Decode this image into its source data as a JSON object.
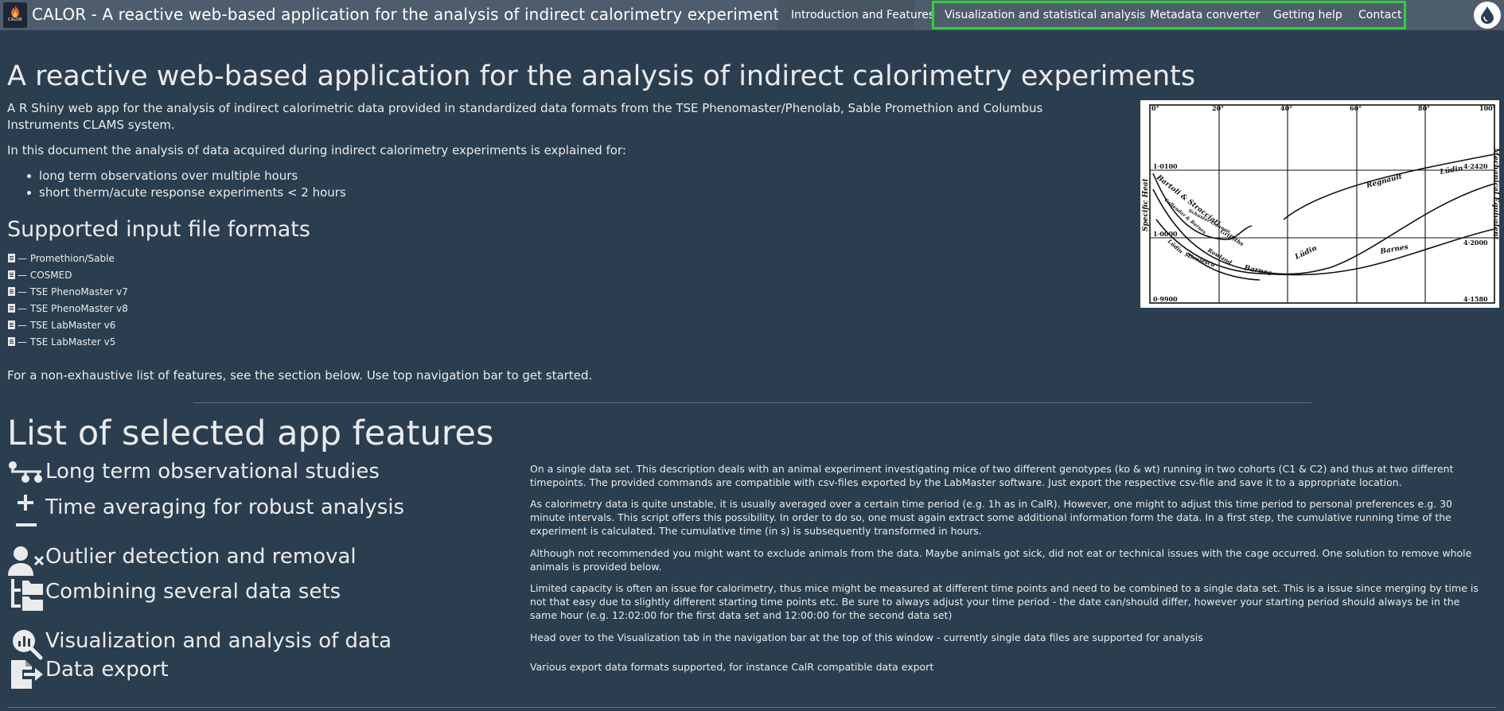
{
  "navbar": {
    "logo_text": "CALOR",
    "brand_title": "CALOR - A reactive web-based application for the analysis of indirect calorimetry experiments",
    "items": [
      {
        "label": "Introduction and Features"
      },
      {
        "label": "Visualization and statistical analysis"
      },
      {
        "label": "Metadata converter"
      },
      {
        "label": "Getting help"
      },
      {
        "label": "Contact"
      }
    ]
  },
  "intro": {
    "heading": "A reactive web-based application for the analysis of indirect calorimetry experiments",
    "paragraph1": "A R Shiny web app for the analysis of indirect calorimetric data provided in standardized data formats from the TSE Phenomaster/Phenolab, Sable Promethion and Columbus Instruments CLAMS system.",
    "paragraph2": "In this document the analysis of data acquired during indirect calorimetry experiments is explained for:",
    "bullets": [
      "long term observations over multiple hours",
      "short therm/acute response experiments < 2 hours"
    ]
  },
  "formats": {
    "heading": "Supported input file formats",
    "items": [
      "— Promethion/Sable",
      "— COSMED",
      "— TSE PhenoMaster v7",
      "— TSE PhenoMaster v8",
      "— TSE LabMaster v6",
      "— TSE LabMaster v5"
    ],
    "footer_text": "For a non-exhaustive list of features, see the section below. Use top navigation bar to get started."
  },
  "figure": {
    "top_labels": [
      "0°",
      "20°",
      "40°",
      "60°",
      "80°",
      "100°"
    ],
    "left_labels": [
      "1·0100",
      "1·0000",
      "0·9900"
    ],
    "right_labels": [
      "4·2420",
      "4·2000",
      "4·1580"
    ],
    "left_axis": "Specific Heat",
    "right_axis": "Mechanical Equivalent",
    "curve_labels": [
      "Bartoli & Stracciati",
      "Regnault",
      "Lüdin",
      "Rowland",
      "Griffiths",
      "Barnes",
      "Lüdin",
      "Barnes",
      "Lüdin",
      "Miculescu",
      "Callendar & Barnes",
      "Schuster-Gannon"
    ]
  },
  "features": {
    "heading": "List of selected app features",
    "items": [
      {
        "icon": "timeline-icon",
        "title": "Long term observational studies",
        "desc": "On a single data set. This description deals with an animal experiment investigating mice of two different genotypes (ko & wt) running in two cohorts (C1 & C2) and thus at two different timepoints. The provided commands are compatible with csv-files exported by the LabMaster software. Just export the respective csv-file and save it to a appropriate location."
      },
      {
        "icon": "plus-minus-icon",
        "title": "Time averaging for robust analysis",
        "desc": "As calorimetry data is quite unstable, it is usually averaged over a certain time period (e.g. 1h as in CalR). However, one might to adjust this time period to personal preferences e.g. 30 minute intervals. This script offers this possibility. In order to do so, one must again extract some additional information form the data. In a first step, the cumulative running time of the experiment is calculated. The cumulative time (in s) is subsequently transformed in hours."
      },
      {
        "icon": "user-remove-icon",
        "title": "Outlier detection and removal",
        "desc": "Although not recommended you might want to exclude animals from the data. Maybe animals got sick, did not eat or technical issues with the cage occurred. One solution to remove whole animals is provided below."
      },
      {
        "icon": "folder-tree-icon",
        "title": "Combining several data sets",
        "desc": "Limited capacity is often an issue for calorimetry, thus mice might be measured at different time points and need to be combined to a single data set. This is a issue since merging by time is not that easy due to slightly different starting time points etc. Be sure to always adjust your time period - the date can/should differ, however your starting period should always be in the same hour (e.g. 12:02:00 for the first data set and 12:00:00 for the second data set)"
      },
      {
        "icon": "magnifier-chart-icon",
        "title": "Visualization and analysis of data",
        "desc": "Head over to the Visualization tab in the navigation bar at the top of this window - currently single data files are supported for analysis"
      },
      {
        "icon": "file-export-icon",
        "title": "Data export",
        "desc": "Various export data formats supported, for instance CalR compatible data export"
      }
    ]
  },
  "colors": {
    "background": "#2b3e50",
    "navbar": "#4e5d6c",
    "highlight": "#2fd134",
    "text": "#ebebeb"
  }
}
